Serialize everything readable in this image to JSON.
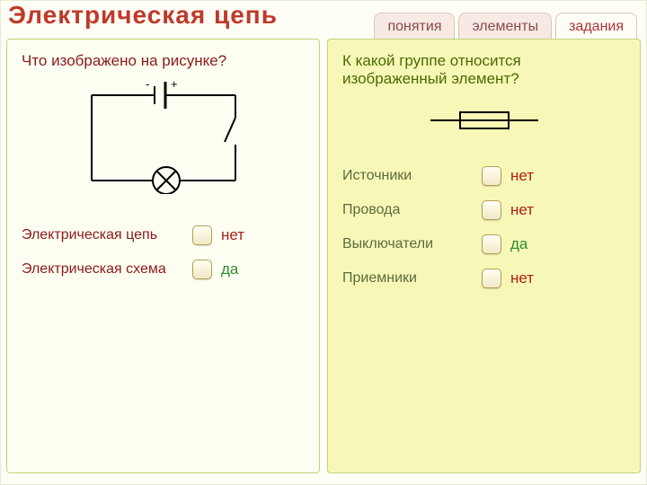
{
  "title": "Электрическая цепь",
  "tabs": [
    {
      "label": "понятия",
      "active": false
    },
    {
      "label": "элементы",
      "active": false
    },
    {
      "label": "задания",
      "active": true
    }
  ],
  "left": {
    "question": "Что изображено на рисунке?",
    "battery_minus": "-",
    "battery_plus": "+",
    "options": [
      {
        "label": "Электрическая цепь",
        "answer": "нет",
        "correct": false
      },
      {
        "label": "Электрическая схема",
        "answer": "да",
        "correct": true
      }
    ]
  },
  "right": {
    "question": "К какой группе относится изображенный элемент?",
    "options": [
      {
        "label": "Источники",
        "answer": "нет",
        "correct": false
      },
      {
        "label": "Провода",
        "answer": "нет",
        "correct": false
      },
      {
        "label": "Выключатели",
        "answer": "да",
        "correct": true
      },
      {
        "label": "Приемники",
        "answer": "нет",
        "correct": false
      }
    ]
  }
}
